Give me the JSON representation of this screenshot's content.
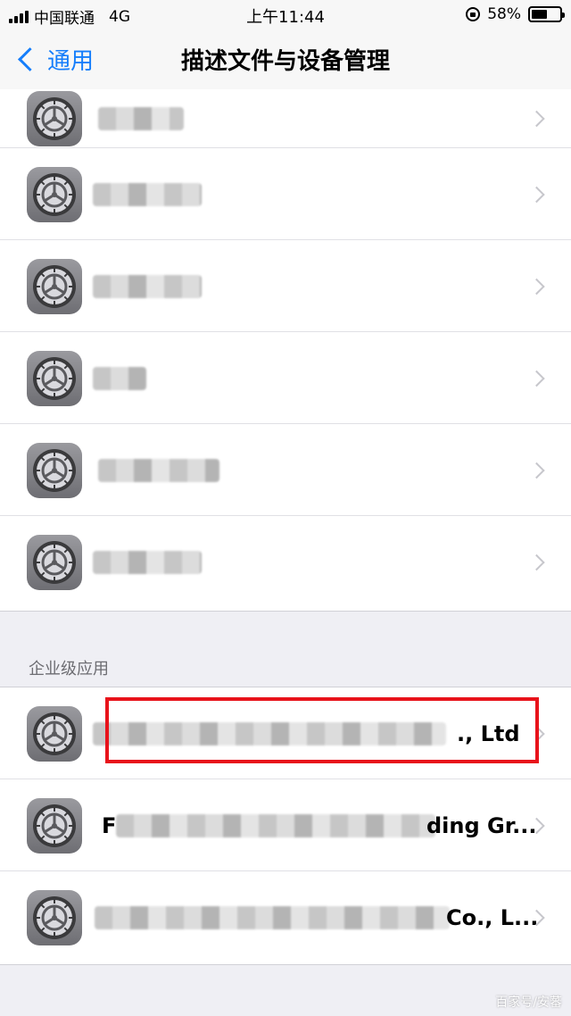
{
  "status_bar": {
    "carrier": "中国联通",
    "network": "4G",
    "time": "上午11:44",
    "battery": "58%",
    "battery_level": 0.58
  },
  "nav": {
    "back_label": "通用",
    "title": "描述文件与设备管理"
  },
  "profiles": [
    {
      "icon": "gear-icon"
    },
    {
      "icon": "gear-icon"
    },
    {
      "icon": "gear-icon"
    },
    {
      "icon": "gear-icon"
    },
    {
      "icon": "gear-icon"
    },
    {
      "icon": "gear-icon"
    }
  ],
  "enterprise": {
    "header": "企业级应用",
    "apps": [
      {
        "visible_text": "., Ltd",
        "lead": ""
      },
      {
        "visible_text": "ding Gr...",
        "lead": "F"
      },
      {
        "visible_text": "Co., L...",
        "lead": ""
      }
    ]
  },
  "watermark": "百家号/安蕃"
}
